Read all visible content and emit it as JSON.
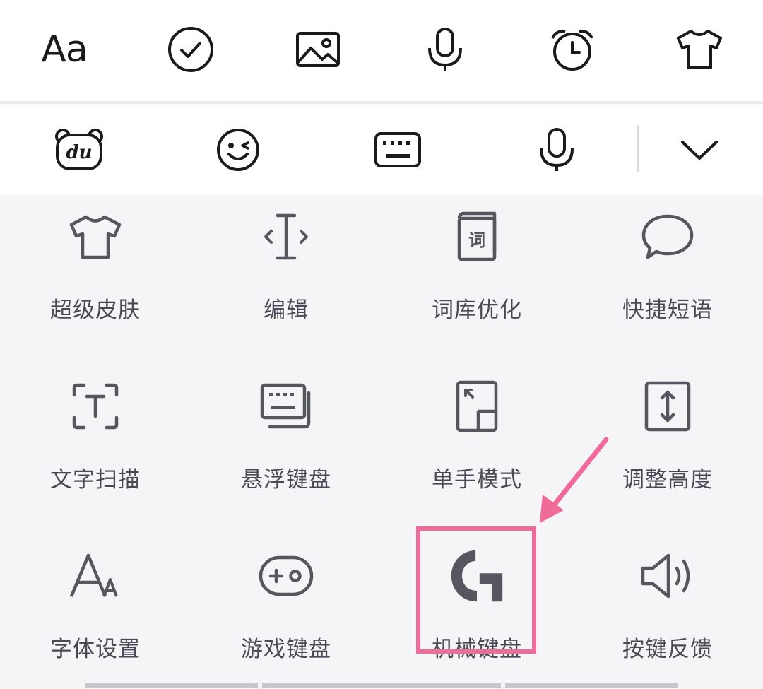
{
  "toolbar_top": {
    "items": [
      {
        "name": "font-style",
        "text": "Aa"
      },
      {
        "name": "check-circle-icon"
      },
      {
        "name": "image-icon"
      },
      {
        "name": "microphone-icon"
      },
      {
        "name": "alarm-clock-icon"
      },
      {
        "name": "tshirt-icon"
      }
    ]
  },
  "toolbar_keyboard": {
    "logo_text": "du",
    "items": [
      "bear-logo-icon",
      "emoji-icon",
      "keyboard-icon",
      "microphone-icon",
      "chevron-down-icon"
    ]
  },
  "panel": {
    "items": [
      {
        "label": "超级皮肤",
        "icon": "tshirt-icon"
      },
      {
        "label": "编辑",
        "icon": "text-cursor-icon"
      },
      {
        "label": "词库优化",
        "icon": "dictionary-icon",
        "icon_text": "词"
      },
      {
        "label": "快捷短语",
        "icon": "speech-bubble-icon"
      },
      {
        "label": "文字扫描",
        "icon": "text-scan-icon"
      },
      {
        "label": "悬浮键盘",
        "icon": "floating-keyboard-icon"
      },
      {
        "label": "单手模式",
        "icon": "one-hand-mode-icon"
      },
      {
        "label": "调整高度",
        "icon": "adjust-height-icon"
      },
      {
        "label": "字体设置",
        "icon": "font-settings-icon"
      },
      {
        "label": "游戏键盘",
        "icon": "gamepad-icon"
      },
      {
        "label": "机械键盘",
        "icon": "mechanical-keyboard-g-icon"
      },
      {
        "label": "按键反馈",
        "icon": "speaker-icon"
      }
    ],
    "highlighted_item": "机械键盘"
  },
  "colors": {
    "icon_dark": "#1a1a1a",
    "icon_gray": "#55565e",
    "highlight": "#f06b98",
    "background": "#f5f5f7"
  }
}
